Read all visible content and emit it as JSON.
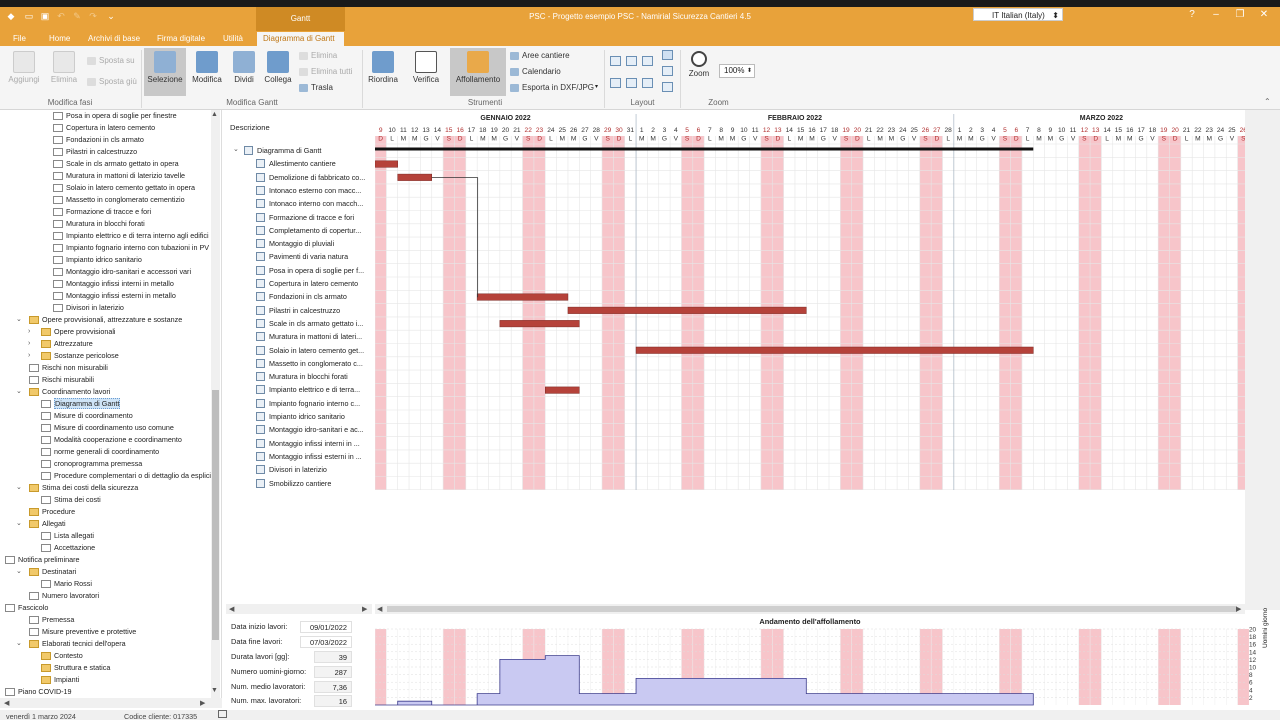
{
  "window": {
    "title": "PSC - Progetto esempio PSC - Namirial Sicurezza Cantieri 4.5",
    "context_tab": "Gantt",
    "language": "IT Italian (Italy)",
    "help": "?",
    "minimize": "–",
    "restore": "❐",
    "close": "✕"
  },
  "menu": [
    "File",
    "Home",
    "Archivi di base",
    "Firma digitale",
    "Utilità",
    "Diagramma di Gantt"
  ],
  "ribbon": {
    "modifica_fasi": {
      "label": "Modifica fasi",
      "aggiungi": "Aggiungi",
      "elimina": "Elimina",
      "sposta_su": "Sposta su",
      "sposta_giu": "Sposta giù"
    },
    "modifica_gantt": {
      "label": "Modifica Gantt",
      "selezione": "Selezione",
      "modifica": "Modifica",
      "dividi": "Dividi",
      "collega": "Collega",
      "elimina": "Elimina",
      "elimina_tutti": "Elimina tutti",
      "trasla": "Trasla"
    },
    "strumenti": {
      "label": "Strumenti",
      "riordina": "Riordina",
      "verifica": "Verifica",
      "affollamento": "Affollamento",
      "aree_cantiere": "Aree cantiere",
      "calendario": "Calendario",
      "esporta": "Esporta in DXF/JPG"
    },
    "layout": {
      "label": "Layout"
    },
    "zoom": {
      "label": "Zoom",
      "button": "Zoom",
      "value": "100%"
    }
  },
  "tree": [
    {
      "label": "Posa in opera di soglie per finestre",
      "level": 4,
      "icon": "doc"
    },
    {
      "label": "Copertura in latero cemento",
      "level": 4,
      "icon": "doc"
    },
    {
      "label": "Fondazioni in cls armato",
      "level": 4,
      "icon": "doc"
    },
    {
      "label": "Pilastri in calcestruzzo",
      "level": 4,
      "icon": "doc"
    },
    {
      "label": "Scale in cls armato gettato in opera",
      "level": 4,
      "icon": "doc"
    },
    {
      "label": "Muratura in mattoni di laterizio tavelle",
      "level": 4,
      "icon": "doc"
    },
    {
      "label": "Solaio in latero cemento gettato in opera",
      "level": 4,
      "icon": "doc"
    },
    {
      "label": "Massetto in conglomerato cementizio",
      "level": 4,
      "icon": "doc"
    },
    {
      "label": "Formazione di tracce e fori",
      "level": 4,
      "icon": "doc"
    },
    {
      "label": "Muratura in blocchi forati",
      "level": 4,
      "icon": "doc"
    },
    {
      "label": "Impianto elettrico e di terra interno agli edifici",
      "level": 4,
      "icon": "doc"
    },
    {
      "label": "Impianto fognario interno con tubazioni in PV",
      "level": 4,
      "icon": "doc"
    },
    {
      "label": "Impianto idrico sanitario",
      "level": 4,
      "icon": "doc"
    },
    {
      "label": "Montaggio idro-sanitari e accessori vari",
      "level": 4,
      "icon": "doc"
    },
    {
      "label": "Montaggio infissi interni in metallo",
      "level": 4,
      "icon": "doc"
    },
    {
      "label": "Montaggio infissi esterni in metallo",
      "level": 4,
      "icon": "doc"
    },
    {
      "label": "Divisori in laterizio",
      "level": 4,
      "icon": "doc"
    },
    {
      "label": "Opere provvisionali, attrezzature e sostanze",
      "level": 2,
      "icon": "fold",
      "toggle": "⌄"
    },
    {
      "label": "Opere provvisionali",
      "level": 3,
      "icon": "fold",
      "toggle": "›"
    },
    {
      "label": "Attrezzature",
      "level": 3,
      "icon": "fold",
      "toggle": "›"
    },
    {
      "label": "Sostanze pericolose",
      "level": 3,
      "icon": "fold",
      "toggle": "›"
    },
    {
      "label": "Rischi non misurabili",
      "level": 2,
      "icon": "doc"
    },
    {
      "label": "Rischi misurabili",
      "level": 2,
      "icon": "doc"
    },
    {
      "label": "Coordinamento lavori",
      "level": 2,
      "icon": "fold",
      "toggle": "⌄"
    },
    {
      "label": "Diagramma di Gantt",
      "level": 3,
      "icon": "doc",
      "selected": true
    },
    {
      "label": "Misure di coordinamento",
      "level": 3,
      "icon": "doc"
    },
    {
      "label": "Misure di coordinamento uso comune",
      "level": 3,
      "icon": "doc"
    },
    {
      "label": "Modalità cooperazione e coordinamento",
      "level": 3,
      "icon": "doc"
    },
    {
      "label": "norme generali di coordinamento",
      "level": 3,
      "icon": "doc"
    },
    {
      "label": "cronoprogramma premessa",
      "level": 3,
      "icon": "doc"
    },
    {
      "label": "Procedure complementari o di dettaglio da esplici",
      "level": 3,
      "icon": "doc"
    },
    {
      "label": "Stima dei costi della sicurezza",
      "level": 2,
      "icon": "fold",
      "toggle": "⌄"
    },
    {
      "label": "Stima dei costi",
      "level": 3,
      "icon": "doc"
    },
    {
      "label": "Procedure",
      "level": 2,
      "icon": "fold"
    },
    {
      "label": "Allegati",
      "level": 2,
      "icon": "fold",
      "toggle": "⌄"
    },
    {
      "label": "Lista allegati",
      "level": 3,
      "icon": "doc"
    },
    {
      "label": "Accettazione",
      "level": 3,
      "icon": "doc"
    },
    {
      "label": "Notifica preliminare",
      "level": 1,
      "icon": "doc",
      "toggle": "⌄"
    },
    {
      "label": "Destinatari",
      "level": 2,
      "icon": "fold",
      "toggle": "⌄"
    },
    {
      "label": "Mario Rossi",
      "level": 3,
      "icon": "doc"
    },
    {
      "label": "Numero lavoratori",
      "level": 2,
      "icon": "doc"
    },
    {
      "label": "Fascicolo",
      "level": 1,
      "icon": "doc",
      "toggle": "⌄"
    },
    {
      "label": "Premessa",
      "level": 2,
      "icon": "doc"
    },
    {
      "label": "Misure preventive e protettive",
      "level": 2,
      "icon": "doc"
    },
    {
      "label": "Elaborati tecnici dell'opera",
      "level": 2,
      "icon": "fold",
      "toggle": "⌄"
    },
    {
      "label": "Contesto",
      "level": 3,
      "icon": "fold"
    },
    {
      "label": "Struttura e statica",
      "level": 3,
      "icon": "fold"
    },
    {
      "label": "Impianti",
      "level": 3,
      "icon": "fold"
    },
    {
      "label": "Piano COVID-19",
      "level": 1,
      "icon": "doc",
      "toggle": "›"
    }
  ],
  "gantt": {
    "description_header": "Descrizione",
    "root": "Diagramma di Gantt",
    "months": [
      "GENNAIO 2022",
      "FEBBRAIO 2022",
      "MARZO 2022"
    ],
    "start_day": 9,
    "start_weekday_index": 6,
    "days_visible": 77,
    "tasks": [
      {
        "name": "Allestimento cantiere",
        "start": 0,
        "dur": 2
      },
      {
        "name": "Demolizione di fabbricato co...",
        "start": 2,
        "dur": 3
      },
      {
        "name": "Intonaco esterno con macc...",
        "start": null,
        "dur": 0
      },
      {
        "name": "Intonaco interno con macch...",
        "start": null,
        "dur": 0
      },
      {
        "name": "Formazione di tracce e fori",
        "start": null,
        "dur": 0
      },
      {
        "name": "Completamento di copertur...",
        "start": null,
        "dur": 0
      },
      {
        "name": "Montaggio di pluviali",
        "start": null,
        "dur": 0
      },
      {
        "name": "Pavimenti di varia natura",
        "start": null,
        "dur": 0
      },
      {
        "name": "Posa in opera di soglie per f...",
        "start": null,
        "dur": 0
      },
      {
        "name": "Copertura in latero cemento",
        "start": null,
        "dur": 0
      },
      {
        "name": "Fondazioni in cls armato",
        "start": 9,
        "dur": 8
      },
      {
        "name": "Pilastri in calcestruzzo",
        "start": 17,
        "dur": 21
      },
      {
        "name": "Scale in cls armato gettato i...",
        "start": 11,
        "dur": 7
      },
      {
        "name": "Muratura in mattoni di lateri...",
        "start": null,
        "dur": 0
      },
      {
        "name": "Solaio in latero cemento get...",
        "start": 23,
        "dur": 35
      },
      {
        "name": "Massetto in conglomerato c...",
        "start": null,
        "dur": 0
      },
      {
        "name": "Muratura in blocchi forati",
        "start": null,
        "dur": 0
      },
      {
        "name": "Impianto elettrico e di terra...",
        "start": 15,
        "dur": 3
      },
      {
        "name": "Impianto fognario interno c...",
        "start": null,
        "dur": 0
      },
      {
        "name": "Impianto idrico sanitario",
        "start": null,
        "dur": 0
      },
      {
        "name": "Montaggio idro-sanitari e ac...",
        "start": null,
        "dur": 0
      },
      {
        "name": "Montaggio infissi interni in ...",
        "start": null,
        "dur": 0
      },
      {
        "name": "Montaggio infissi esterni in ...",
        "start": null,
        "dur": 0
      },
      {
        "name": "Divisori in laterizio",
        "start": null,
        "dur": 0
      },
      {
        "name": "Smobilizzo cantiere",
        "start": null,
        "dur": 0
      }
    ],
    "colors": {
      "weekend": "#f7c5ca",
      "bar": "#b5423a",
      "grid": "#e6e6e6",
      "summary": "#111111",
      "load_fill": "#c9c9f2"
    }
  },
  "info": {
    "data_inizio_label": "Data inizio lavori:",
    "data_inizio": "09/01/2022",
    "data_fine_label": "Data fine lavori:",
    "data_fine": "07/03/2022",
    "durata_label": "Durata lavori [gg]:",
    "durata": "39",
    "uomini_giorno_label": "Numero uomini-giorno:",
    "uomini_giorno": "287",
    "medio_label": "Num. medio lavoratori:",
    "medio": "7,36",
    "max_label": "Num. max. lavoratori:",
    "max": "16"
  },
  "chart_data": {
    "type": "area",
    "title": "Andamento dell'affollamento",
    "ylabel": "Uomini giorno",
    "ylim": [
      0,
      20
    ],
    "yticks": [
      2,
      4,
      6,
      8,
      10,
      12,
      14,
      16,
      18,
      20
    ],
    "x_unit": "day index from 09/01/2022",
    "x": [
      0,
      2,
      2,
      5,
      5,
      9,
      9,
      11,
      11,
      15,
      15,
      18,
      18,
      23,
      23,
      38,
      38,
      58,
      58
    ],
    "y": [
      0,
      0,
      1,
      1,
      0,
      0,
      3,
      3,
      12,
      12,
      13,
      13,
      3,
      3,
      7,
      7,
      3,
      3,
      0
    ]
  },
  "status": {
    "date": "venerdì 1 marzo 2024",
    "cliente": "Codice cliente: 017335"
  }
}
